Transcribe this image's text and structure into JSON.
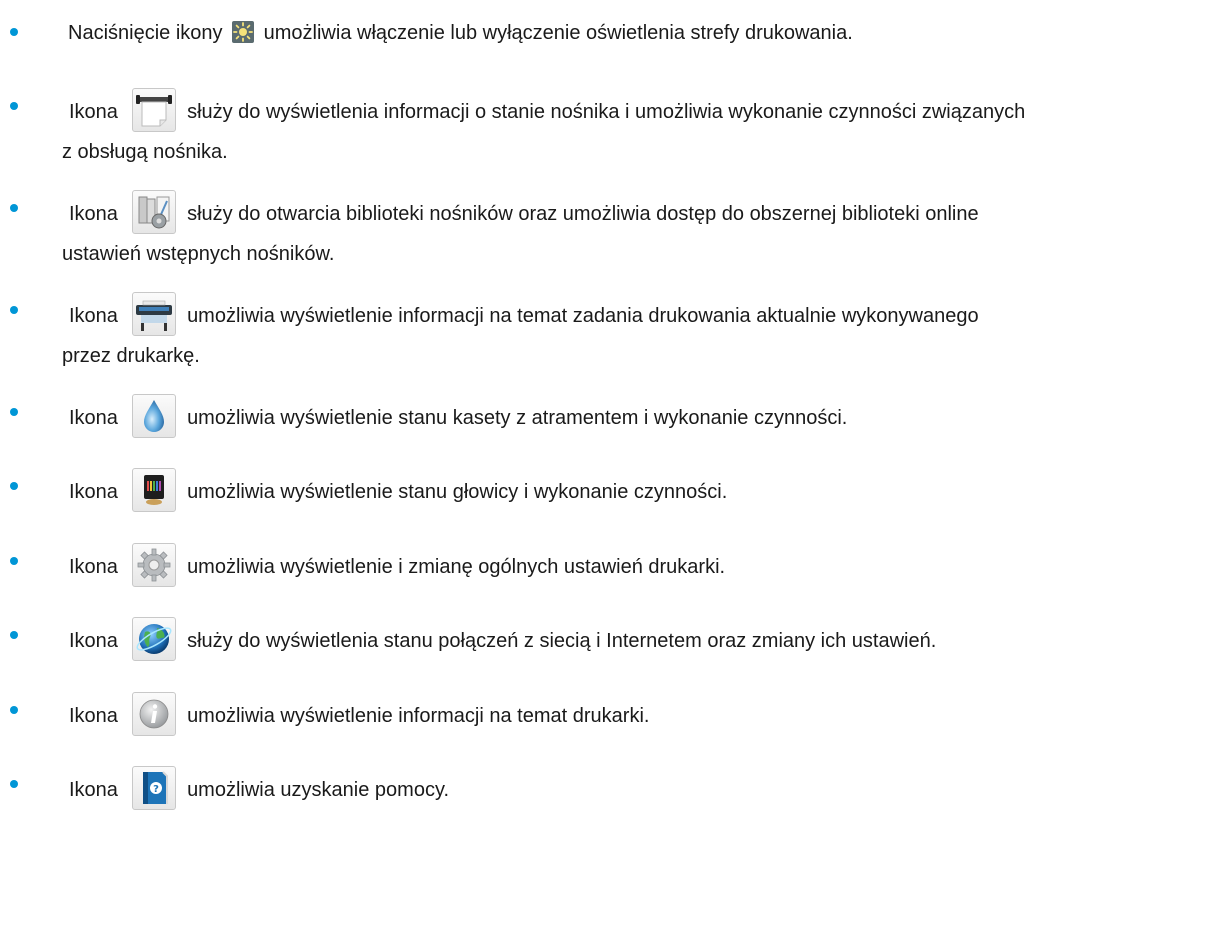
{
  "items": [
    {
      "before": "Naciśnięcie ikony",
      "after": "umożliwia włączenie lub wyłączenie oświetlenia strefy drukowania.",
      "icon": "light-icon"
    },
    {
      "before": "Ikona",
      "after": "służy do wyświetlenia informacji o stanie nośnika i umożliwia wykonanie czynności związanych",
      "line2": "z obsługą nośnika.",
      "icon": "media-icon"
    },
    {
      "before": "Ikona",
      "after": "służy do otwarcia biblioteki nośników oraz umożliwia dostęp do obszernej biblioteki online",
      "line2": "ustawień wstępnych nośników.",
      "icon": "media-library-icon"
    },
    {
      "before": "Ikona",
      "after": "umożliwia wyświetlenie informacji na temat zadania drukowania aktualnie wykonywanego",
      "line2": "przez drukarkę.",
      "icon": "printer-icon"
    },
    {
      "before": "Ikona",
      "after": "umożliwia wyświetlenie stanu kasety z atramentem i wykonanie czynności.",
      "icon": "ink-drop-icon"
    },
    {
      "before": "Ikona",
      "after": "umożliwia wyświetlenie stanu głowicy i wykonanie czynności.",
      "icon": "printhead-icon"
    },
    {
      "before": "Ikona",
      "after": "umożliwia wyświetlenie i zmianę ogólnych ustawień drukarki.",
      "icon": "gear-icon"
    },
    {
      "before": "Ikona",
      "after": "służy do wyświetlenia stanu połączeń z siecią i Internetem oraz zmiany ich ustawień.",
      "icon": "globe-icon"
    },
    {
      "before": "Ikona",
      "after": "umożliwia wyświetlenie informacji na temat drukarki.",
      "icon": "info-icon"
    },
    {
      "before": "Ikona",
      "after": "umożliwia uzyskanie pomocy.",
      "icon": "help-book-icon"
    }
  ],
  "colors": {
    "bullet": "#0096d6",
    "text": "#1a1a1a"
  }
}
